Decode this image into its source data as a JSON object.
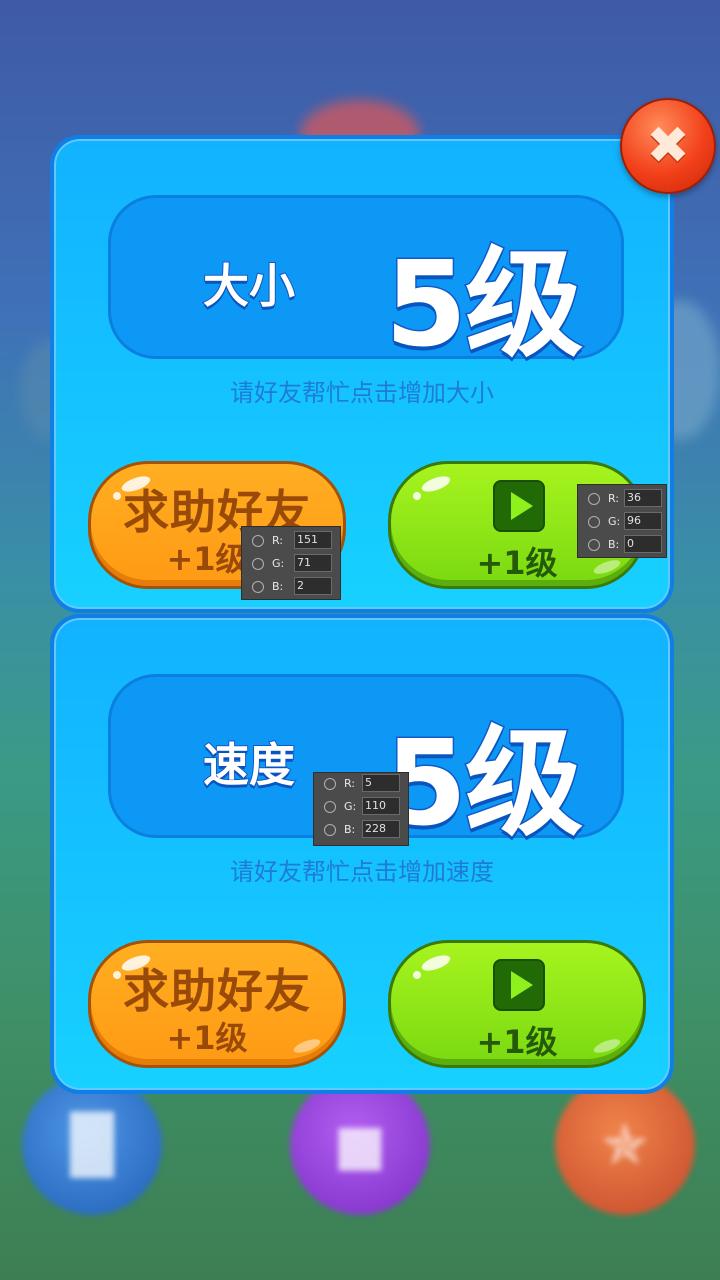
{
  "panels": {
    "size": {
      "stat_name": "大小",
      "level": "5级",
      "hint": "请好友帮忙点击增加大小",
      "help_button": {
        "title": "求助好友",
        "sub": "+1级"
      },
      "video_button": {
        "sub": "+1级",
        "icon": "play-icon"
      }
    },
    "speed": {
      "stat_name": "速度",
      "level": "5级",
      "hint": "请好友帮忙点击增加速度",
      "help_button": {
        "title": "求助好友",
        "sub": "+1级"
      },
      "video_button": {
        "sub": "+1级",
        "icon": "play-icon"
      }
    }
  },
  "close_button": {
    "icon": "close-icon"
  },
  "color_pickers": [
    {
      "r_label": "R:",
      "g_label": "G:",
      "b_label": "B:",
      "r": "151",
      "g": "71",
      "b": "2"
    },
    {
      "r_label": "R:",
      "g_label": "G:",
      "b_label": "B:",
      "r": "36",
      "g": "96",
      "b": "0"
    },
    {
      "r_label": "R:",
      "g_label": "G:",
      "b_label": "B:",
      "r": "5",
      "g": "110",
      "b": "228"
    }
  ],
  "dock": [
    {
      "icon": "rank-icon"
    },
    {
      "icon": "shirt-icon"
    },
    {
      "icon": "share-icon"
    }
  ],
  "colors": {
    "panel": "#12b2ff",
    "help_button": "#ff9a14",
    "help_text": "#974702",
    "video_button": "#7ad911",
    "video_text": "#246000",
    "stat_box": "#056ee4"
  }
}
